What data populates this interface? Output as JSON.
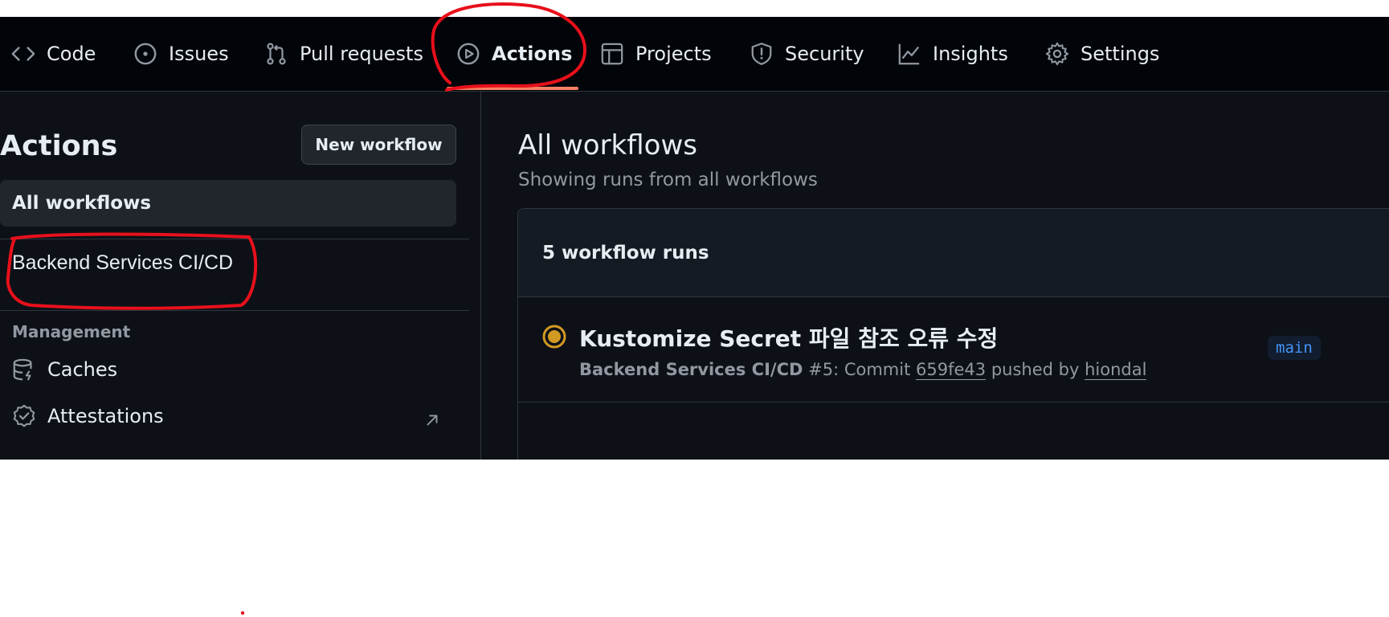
{
  "topnav": {
    "items": [
      {
        "label": "Code",
        "icon": "code-icon"
      },
      {
        "label": "Issues",
        "icon": "issue-opened-icon"
      },
      {
        "label": "Pull requests",
        "icon": "git-pull-request-icon"
      },
      {
        "label": "Actions",
        "icon": "play-icon",
        "active": true
      },
      {
        "label": "Projects",
        "icon": "table-icon"
      },
      {
        "label": "Security",
        "icon": "shield-icon"
      },
      {
        "label": "Insights",
        "icon": "graph-icon"
      },
      {
        "label": "Settings",
        "icon": "gear-icon"
      }
    ]
  },
  "sidebar": {
    "title": "Actions",
    "new_workflow_label": "New workflow",
    "all_workflows_label": "All workflows",
    "workflows": [
      "Backend Services CI/CD"
    ],
    "management_heading": "Management",
    "management_items": [
      {
        "label": "Caches",
        "icon": "database-icon"
      },
      {
        "label": "Attestations",
        "icon": "verified-icon",
        "external": true
      }
    ]
  },
  "main": {
    "title": "All workflows",
    "subtitle": "Showing runs from all workflows",
    "runs_count_label": "5 workflow runs",
    "runs": [
      {
        "title": "Kustomize Secret 파일 참조 오류 수정",
        "status": "in-progress",
        "workflow": "Backend Services CI/CD",
        "run_number": "#5",
        "commit_prefix": ": Commit",
        "commit_sha": "659fe43",
        "pushed_by_text": "pushed by",
        "actor": "hiondal",
        "branch": "main"
      }
    ]
  },
  "colors": {
    "background": "#0d1117",
    "header": "#010409",
    "accent_underline": "#f78166",
    "in_progress": "#d29922",
    "branch_text": "#4493f8",
    "annotation": "#e8101b"
  }
}
